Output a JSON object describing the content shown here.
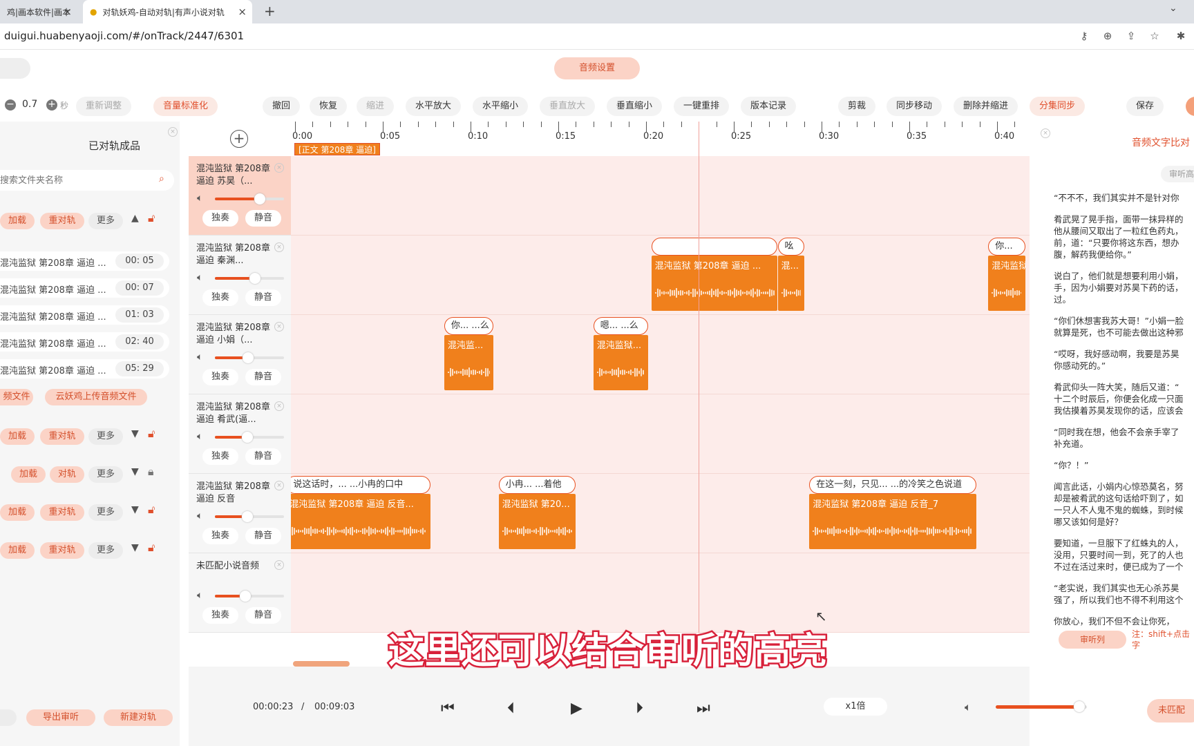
{
  "browser": {
    "tabs": [
      {
        "label": "鸡|画本软件|画本"
      },
      {
        "label": "对轨妖鸡-自动对轨|有声小说对轨"
      }
    ],
    "new_tab": "+",
    "url": "duigui.huabenyaoji.com/#/onTrack/2447/6301"
  },
  "header": {
    "audio_settings": "音频设置"
  },
  "toolbar": {
    "step_value": "0.7",
    "step_unit": "秒",
    "buttons": [
      "重新调整",
      "音量标准化",
      "撤回",
      "恢复",
      "缩进",
      "水平放大",
      "水平缩小",
      "垂直放大",
      "垂直缩小",
      "一键重排",
      "版本记录",
      "剪裁",
      "同步移动",
      "删除并缩进",
      "分集同步",
      "保存"
    ]
  },
  "left_panel": {
    "title": "已对轨成品",
    "search_placeholder": "搜索文件夹名称",
    "group_buttons": {
      "load": "加载",
      "realign": "重对轨",
      "more": "更多",
      "align": "对轨"
    },
    "files": [
      {
        "name": "混沌监狱 第208章 逼迫 ...",
        "duration": "00: 05"
      },
      {
        "name": "混沌监狱 第208章 逼迫 ...",
        "duration": "00: 07"
      },
      {
        "name": "混沌监狱 第208章 逼迫 ...",
        "duration": "01: 03"
      },
      {
        "name": "混沌监狱 第208章 逼迫 ...",
        "duration": "02: 40"
      },
      {
        "name": "混沌监狱 第208章 逼迫 ...",
        "duration": "05: 29"
      }
    ],
    "upload_local": "频文件",
    "upload_cloud": "云妖鸡上传音频文件",
    "export_review": "导出审听",
    "new_align": "新建对轨"
  },
  "tracks": [
    {
      "name": "混沌监狱 第208章 逼迫 苏昊（...",
      "volume": 0.65
    },
    {
      "name": "混沌监狱 第208章 逼迫 秦渊...",
      "volume": 0.58
    },
    {
      "name": "混沌监狱 第208章 逼迫 小娟（...",
      "volume": 0.48
    },
    {
      "name": "混沌监狱 第208章 逼迫 肴武(逼...",
      "volume": 0.47
    },
    {
      "name": "混沌监狱 第208章 逼迫 反音",
      "volume": 0.47
    },
    {
      "name": "未匹配小说音频",
      "volume": 0.44
    }
  ],
  "track_buttons": {
    "solo": "独奏",
    "mute": "静音"
  },
  "timeline": {
    "ticks": [
      "0:00",
      "0:05",
      "0:10",
      "0:15",
      "0:20",
      "0:25",
      "0:30",
      "0:35",
      "0:40"
    ],
    "section_label": "[正文 第208章 逼迫]",
    "playhead_seconds": 23,
    "clips": [
      {
        "lane": 1,
        "start": 20.3,
        "end": 27.5,
        "name": "混沌监狱 第208章 逼迫 ...",
        "bubble": ""
      },
      {
        "lane": 1,
        "start": 27.5,
        "end": 29.0,
        "name": "混...",
        "bubble": "吆"
      },
      {
        "lane": 1,
        "start": 39.5,
        "end": 41.6,
        "name": "混沌监狱",
        "bubble": "你..."
      },
      {
        "lane": 2,
        "start": 8.5,
        "end": 11.3,
        "name": "混沌监...",
        "bubble": "你... ...么"
      },
      {
        "lane": 2,
        "start": 17.0,
        "end": 20.1,
        "name": "混沌监狱...",
        "bubble": "嗯... ...么"
      },
      {
        "lane": 4,
        "start": -0.5,
        "end": 7.7,
        "name": "混沌监狱 第208章 逼迫 反音...",
        "bubble": "说这话时，... ...小冉的口中"
      },
      {
        "lane": 4,
        "start": 11.6,
        "end": 16.0,
        "name": "混沌监狱 第20...",
        "bubble": "小冉... ...着他"
      },
      {
        "lane": 4,
        "start": 29.3,
        "end": 38.8,
        "name": "混沌监狱 第208章 逼迫 反音_7",
        "bubble": "在这一刻，只见... ...的冷笑之色说道"
      }
    ]
  },
  "right_panel": {
    "title": "音频文字比对",
    "review_btn": "审听高",
    "paragraphs": [
      "“不不不，我们其实并不是针对你",
      "肴武晃了晃手指，面带一抹异样的\n他从腰间又取出了一粒红色药丸，\n前，道：“只要你将这东西，想办\n腹，解药我便给你。”",
      "说白了，他们就是想要利用小娟，\n手，因为小娟要对苏昊下药的话，\n过。",
      "“你们休想害我苏大哥！”小娟一脸\n就算是死，也不可能去做出这种邪",
      "“哎呀，我好感动啊，我要是苏昊\n你感动死的。”",
      "肴武仰头一阵大笑，随后又道：“\n十二个时辰后，你便会化成一只面\n我估摸着苏昊发现你的话，应该会",
      "“同时我在想，他会不会亲手宰了\n补充道。",
      "“你？！”",
      "闻言此话，小娟内心惊恐莫名，努\n却是被肴武的这句话给吓到了，如\n一只人不人鬼不鬼的蜘蛛，到时候\n哪又该如何是好？",
      "要知道，一旦服下了红蛛丸的人，\n没用，只要时间一到，死了的人也\n不过在活过来时，便已成为了一个",
      "“老实说，我们其实也无心杀苏昊\n强了，所以我们也不得不利用这个",
      "你放心，我们不但不会让你死，"
    ],
    "review_list": "审听列",
    "note": "注：shift+点击\n字"
  },
  "player": {
    "current": "00:00:23",
    "separator": "/",
    "total": "00:09:03",
    "speed": "x1倍",
    "volume": 0.92,
    "unmatched": "未匹配"
  },
  "subtitle": "这里还可以结合审听的高亮"
}
